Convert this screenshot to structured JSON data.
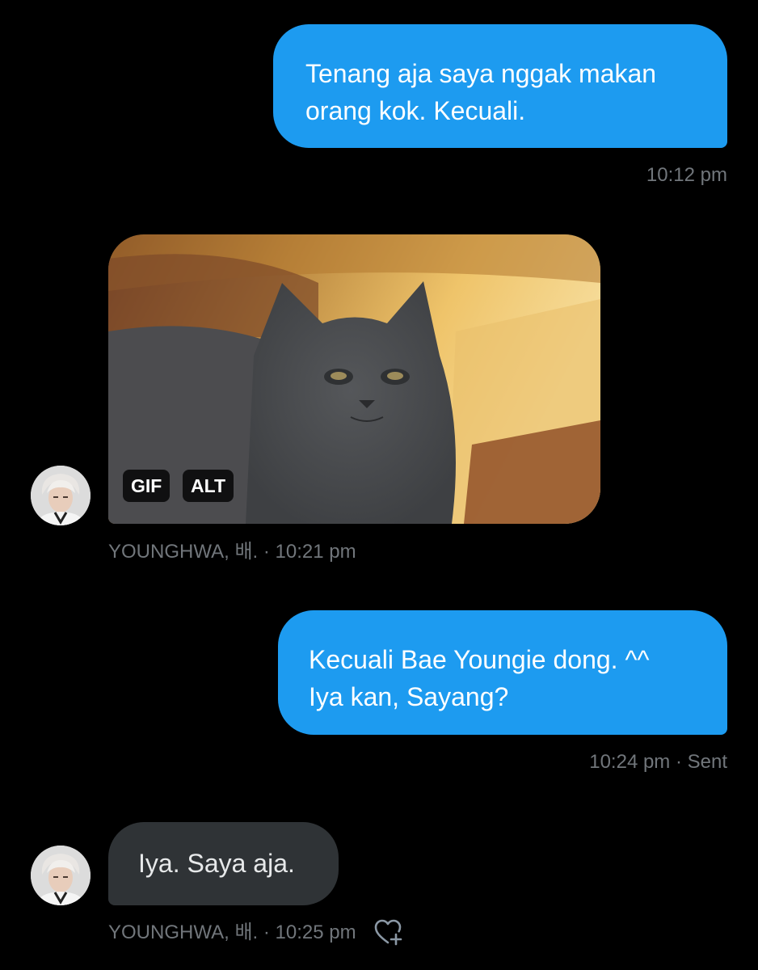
{
  "messages": [
    {
      "direction": "outgoing",
      "lines": [
        "Tenang aja saya nggak makan",
        "orang kok. Kecuali."
      ],
      "meta": "10:12 pm"
    },
    {
      "direction": "incoming",
      "type": "gif",
      "badges": {
        "gif": "GIF",
        "alt": "ALT"
      },
      "meta": "YOUNGHWA, 배. · 10:21 pm"
    },
    {
      "direction": "outgoing",
      "lines": [
        "Kecuali Bae Youngie dong. ^^",
        "Iya kan, Sayang?"
      ],
      "meta": "10:24 pm · Sent"
    },
    {
      "direction": "incoming",
      "text": "Iya. Saya aja.",
      "meta": "YOUNGHWA, 배. · 10:25 pm",
      "reaction_icon": "heart-plus-icon"
    }
  ],
  "colors": {
    "background": "#000000",
    "outgoing_bubble": "#1d9bf0",
    "incoming_bubble": "#2f3336",
    "meta_text": "#71767b"
  }
}
